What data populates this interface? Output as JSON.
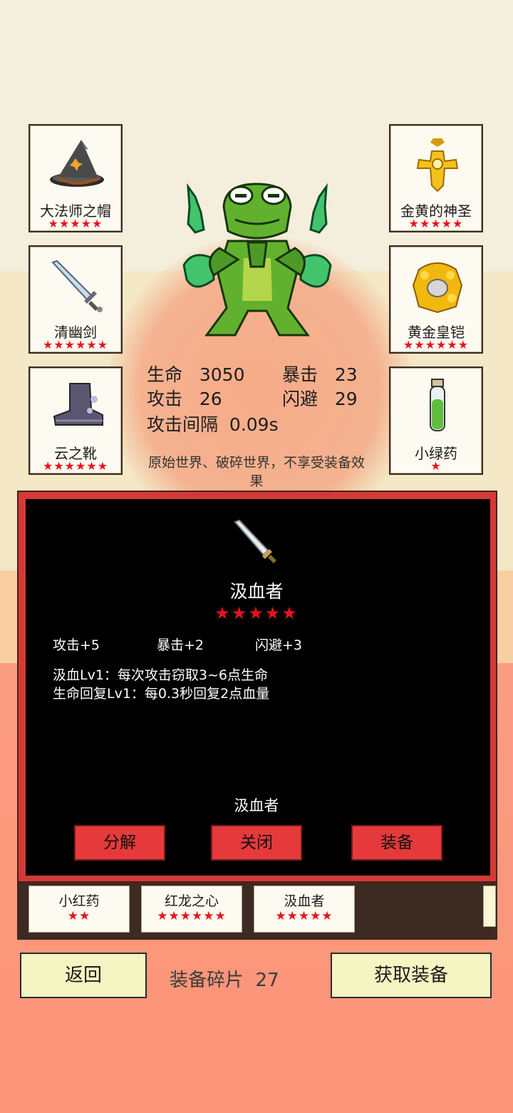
{
  "equip_slots": {
    "hat": {
      "name": "大法师之帽",
      "stars": "★★★★★"
    },
    "sword": {
      "name": "清幽剑",
      "stars": "★★★★★★"
    },
    "boots": {
      "name": "云之靴",
      "stars": "★★★★★★"
    },
    "amulet": {
      "name": "金黄的神圣",
      "stars": "★★★★★"
    },
    "armor": {
      "name": "黄金皇铠",
      "stars": "★★★★★★"
    },
    "potion": {
      "name": "小绿药",
      "stars": "★"
    }
  },
  "stats": {
    "hp_label": "生命",
    "hp_value": "3050",
    "crit_label": "暴击",
    "crit_value": "23",
    "atk_label": "攻击",
    "atk_value": "26",
    "dodge_label": "闪避",
    "dodge_value": "29",
    "interval_label": "攻击间隔",
    "interval_value": "0.09s"
  },
  "world_note": "原始世界、破碎世界，不享受装备效果",
  "item_panel": {
    "icon": "dagger-icon",
    "name": "汲血者",
    "stars": "★★★★★",
    "attrs": [
      "攻击+5",
      "暴击+2",
      "闪避+3"
    ],
    "skills": [
      "汲血Lv1：每次攻击窃取3~6点生命",
      "生命回复Lv1：每0.3秒回复2点血量"
    ],
    "name_footer": "汲血者",
    "buttons": {
      "decompose": "分解",
      "close": "关闭",
      "equip": "装备"
    }
  },
  "inventory": [
    {
      "name": "小红药",
      "stars": "★★"
    },
    {
      "name": "红龙之心",
      "stars": "★★★★★★"
    },
    {
      "name": "汲血者",
      "stars": "★★★★★"
    }
  ],
  "footer": {
    "back_label": "返回",
    "fragments_label": "装备碎片",
    "fragments_value": "27",
    "get_equip_label": "获取装备"
  },
  "colors": {
    "star": "#e8141d",
    "panel_border": "#d33a35",
    "button_red": "#e6393b",
    "button_yellow": "#f4f5c2"
  }
}
